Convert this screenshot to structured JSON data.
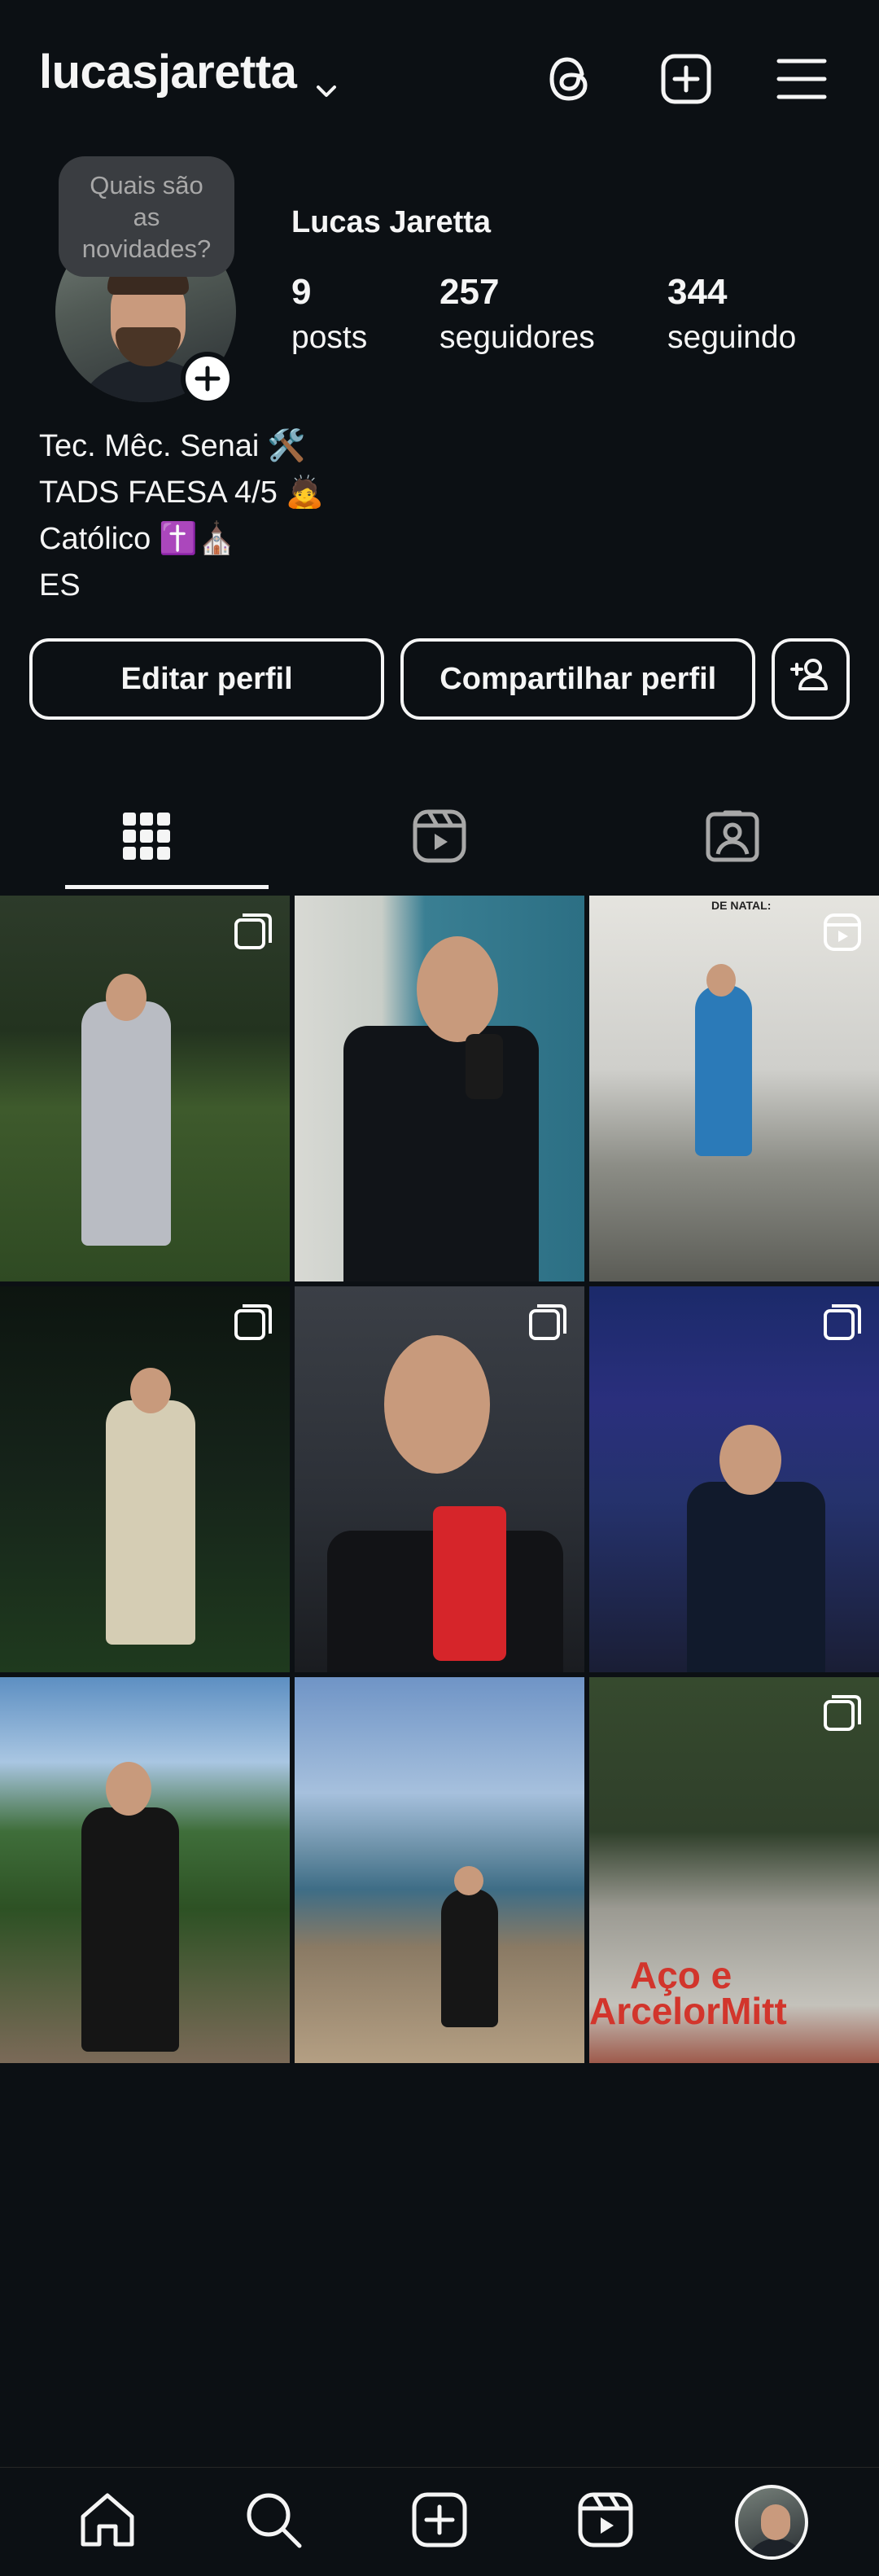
{
  "header": {
    "username": "lucasjaretta"
  },
  "profile": {
    "note": "Quais são as novidades?",
    "display_name": "Lucas Jaretta",
    "stats": [
      {
        "value": "9",
        "label": "posts"
      },
      {
        "value": "257",
        "label": "seguidores"
      },
      {
        "value": "344",
        "label": "seguindo"
      }
    ],
    "bio": [
      {
        "text": "Tec. Mêc. Senai",
        "emoji": "🛠️"
      },
      {
        "text": "TADS FAESA 4/5",
        "emoji": "🙇"
      },
      {
        "text": "Católico",
        "emoji": "✝️⛪"
      },
      {
        "text": "ES",
        "emoji": ""
      }
    ]
  },
  "actions": {
    "edit_label": "Editar perfil",
    "share_label": "Compartilhar perfil"
  },
  "posts": {
    "caption_3": "DE NATAL:",
    "sign_9_line1": "Aço e",
    "sign_9_line2": "ArcelorMitt"
  },
  "colors": {
    "background": "#0c1014",
    "text": "#f5f5f5",
    "note_bubble": "#3a3d41"
  },
  "icons": {
    "threads": "threads-icon",
    "create": "plus-square-icon",
    "menu": "hamburger-menu-icon",
    "grid": "grid-icon",
    "reels": "reels-icon",
    "tagged": "tagged-icon",
    "home": "home-icon",
    "search": "search-icon",
    "reel_badge": "reel-badge-icon",
    "carousel_badge": "carousel-badge-icon"
  }
}
